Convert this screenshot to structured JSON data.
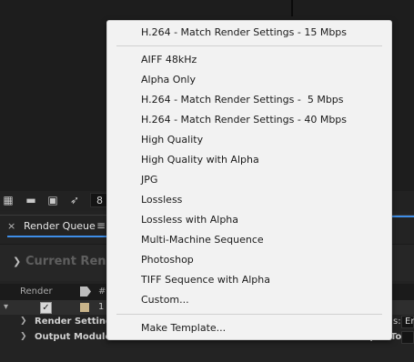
{
  "menu": {
    "top_item": "H.264 - Match Render Settings - 15 Mbps",
    "items": [
      "AIFF 48kHz",
      "Alpha Only",
      "H.264 - Match Render Settings -  5 Mbps",
      "H.264 - Match Render Settings - 40 Mbps",
      "High Quality",
      "High Quality with Alpha",
      "JPG",
      "Lossless",
      "Lossless with Alpha",
      "Multi-Machine Sequence",
      "Photoshop",
      "TIFF Sequence with Alpha",
      "Custom..."
    ],
    "footer_item": "Make Template..."
  },
  "toolbar": {
    "number_value": "8",
    "icons": [
      "grid-icon",
      "folder-icon",
      "film-icon",
      "feather-icon"
    ]
  },
  "panel": {
    "tab_close": "×",
    "tab_title": "Render Queue",
    "tab_menu": "≡",
    "current_render_label": "Current Render"
  },
  "queue": {
    "header_render": "Render",
    "header_hash": "#",
    "item_number": "1",
    "render_settings_label": "Render Settings:",
    "output_module_label": "Output Module:",
    "right_render_settings_partial": "s:",
    "right_render_settings_value": "Er",
    "right_output_partial": "Output To:"
  },
  "colors": {
    "accent": "#3e8ee8",
    "menu_bg": "#f2f2f2",
    "label_swatch": "#c9b48a"
  }
}
